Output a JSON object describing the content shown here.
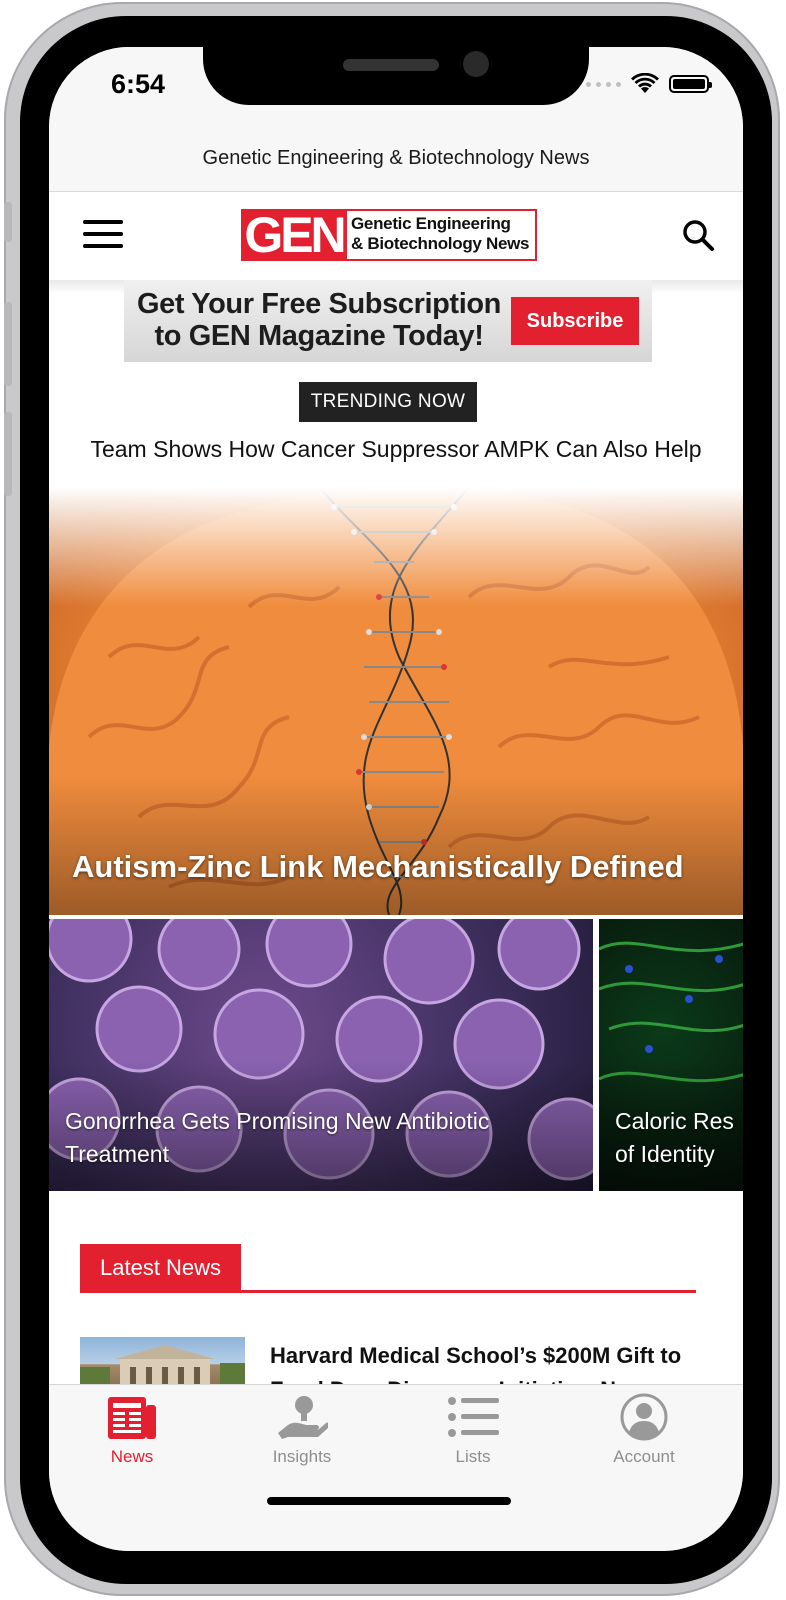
{
  "status_bar": {
    "time": "6:54"
  },
  "app_title": "Genetic Engineering & Biotechnology News",
  "logo": {
    "mark": "GEN",
    "line1": "Genetic Engineering",
    "line2": "& Biotechnology News"
  },
  "ad_banner": {
    "line1": "Get Your Free Subscription",
    "line2": "to GEN Magazine Today!",
    "button": "Subscribe"
  },
  "trending": {
    "badge": "TRENDING NOW",
    "headline": "Team Shows How Cancer Suppressor AMPK Can Also Help"
  },
  "hero": {
    "title": "Autism-Zinc Link Mechanistically Defined"
  },
  "cards": [
    {
      "line1": "Gonorrhea Gets Promising New Antibiotic",
      "line2": "Treatment"
    },
    {
      "line1": "Caloric Res",
      "line2": "of Identity"
    }
  ],
  "latest_news": {
    "label": "Latest News",
    "items": [
      {
        "line1": "Harvard Medical School’s $200M Gift to",
        "line2": "Fund Drug Discovery Initiative, New"
      }
    ]
  },
  "tabs": [
    {
      "label": "News",
      "icon": "newspaper-icon",
      "active": true
    },
    {
      "label": "Insights",
      "icon": "hand-lightbulb-icon",
      "active": false
    },
    {
      "label": "Lists",
      "icon": "list-icon",
      "active": false
    },
    {
      "label": "Account",
      "icon": "account-icon",
      "active": false
    }
  ],
  "colors": {
    "brand_red": "#e3202f",
    "tab_inactive": "#8e8e8e",
    "trending_bg": "#222222"
  }
}
